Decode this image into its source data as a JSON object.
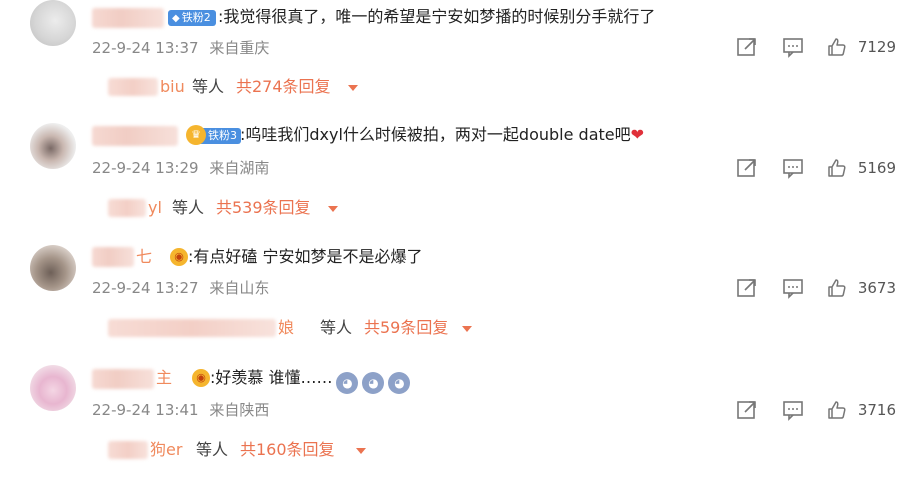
{
  "comments": [
    {
      "name_tail": "",
      "badge": "铁粉2",
      "text": ":我觉得很真了，唯一的希望是宁安如梦播的时候别分手就行了",
      "time": "22-9-24 13:37",
      "location": "来自重庆",
      "likes": "7129",
      "reply": {
        "name_tail": "biu",
        "deng": "等人",
        "total": "共274条回复"
      }
    },
    {
      "name_tail": "",
      "badge": "铁粉3",
      "text": ":呜哇我们dxyl什么时候被拍，两对一起double date吧",
      "time": "22-9-24 13:29",
      "location": "来自湖南",
      "likes": "5169",
      "reply": {
        "name_tail": "yl",
        "deng": "等人",
        "total": "共539条回复"
      }
    },
    {
      "name_tail": "七",
      "text": ":有点好磕 宁安如梦是不是必爆了",
      "time": "22-9-24 13:27",
      "location": "来自山东",
      "likes": "3673",
      "reply": {
        "name_tail": "娘",
        "deng": "等人",
        "total": "共59条回复"
      }
    },
    {
      "name_tail": "主",
      "text": ":好羡慕 谁懂……",
      "time": "22-9-24 13:41",
      "location": "来自陕西",
      "likes": "3716",
      "reply": {
        "name_tail": "狗er",
        "deng": "等人",
        "total": "共160条回复"
      }
    }
  ],
  "icons": {
    "share": "share-icon",
    "comment": "comment-icon",
    "like": "thumbs-up-icon",
    "heart": "red-heart-emoji",
    "ghost": "scared-face-emoji"
  },
  "colors": {
    "accent": "#eb7350",
    "badge": "#4a8fe0",
    "meta": "#888888"
  }
}
